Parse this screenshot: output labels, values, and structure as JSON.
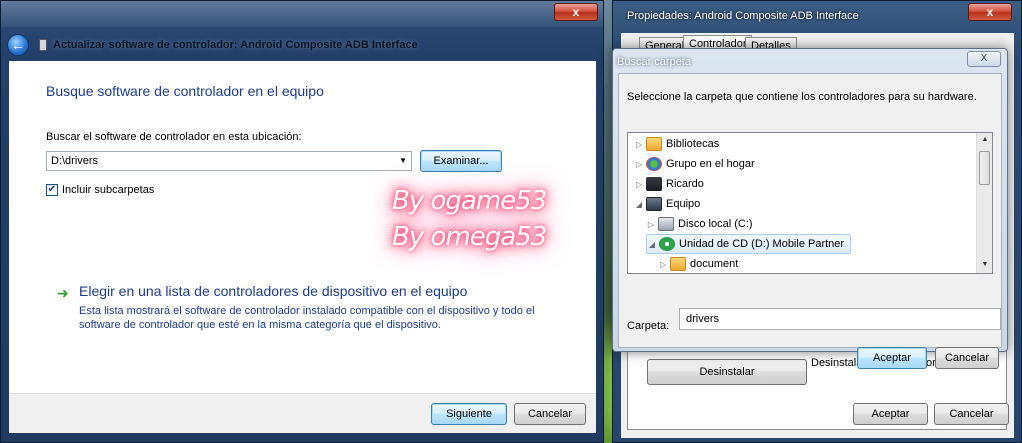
{
  "left_window": {
    "nav_title": "Actualizar software de controlador: Android Composite ADB Interface",
    "close_label": "x",
    "heading": "Busque software de controlador en el equipo",
    "location_label": "Buscar el software de controlador en esta ubicación:",
    "location_value": "D:\\drivers",
    "browse_button": "Examinar...",
    "include_subfolders_label": "Incluir subcarpetas",
    "include_subfolders_checked": true,
    "choose_title": "Elegir en una lista de controladores de dispositivo en el equipo",
    "choose_description": "Esta lista mostrará el software de controlador instalado compatible con el dispositivo y todo el software de controlador que esté en la misma categoría que el dispositivo.",
    "next_button": "Siguiente",
    "cancel_button": "Cancelar"
  },
  "watermark": {
    "line1": "By ogame53",
    "line2": "By omega53"
  },
  "properties_window": {
    "title": "Propiedades: Android Composite ADB Interface",
    "close_label": "x",
    "tabs": [
      "General",
      "Controlador",
      "Detalles"
    ],
    "active_tab": "Controlador",
    "uninstall_button": "Desinstalar",
    "uninstall_description": "Desinstalar el controlador (avanzado).",
    "accept_button": "Aceptar",
    "cancel_button": "Cancelar"
  },
  "browse_dialog": {
    "title": "Buscar carpeta",
    "close_label": "X",
    "description": "Seleccione la carpeta que contiene los controladores para su hardware.",
    "tree": [
      {
        "label": "Bibliotecas",
        "icon": "folder-icon",
        "expander": "▷"
      },
      {
        "label": "Grupo en el hogar",
        "icon": "homegroup-icon",
        "expander": "▷"
      },
      {
        "label": "Ricardo",
        "icon": "user-icon",
        "expander": "▷"
      },
      {
        "label": "Equipo",
        "icon": "computer-icon",
        "expander": "◢"
      },
      {
        "label": "Disco local (C:)",
        "icon": "disk-icon",
        "expander": "▷"
      },
      {
        "label": "Unidad de CD (D:) Mobile Partner",
        "icon": "cd-drive-icon",
        "expander": "◢",
        "selected": true
      },
      {
        "label": "document",
        "icon": "folder-icon",
        "expander": "▷"
      }
    ],
    "folder_label": "Carpeta:",
    "folder_value": "drivers",
    "accept_button": "Aceptar",
    "cancel_button": "Cancelar"
  },
  "colors": {
    "link_blue": "#1d3c8f",
    "accent_green": "#2ea02e",
    "close_red": "#d4513c"
  }
}
